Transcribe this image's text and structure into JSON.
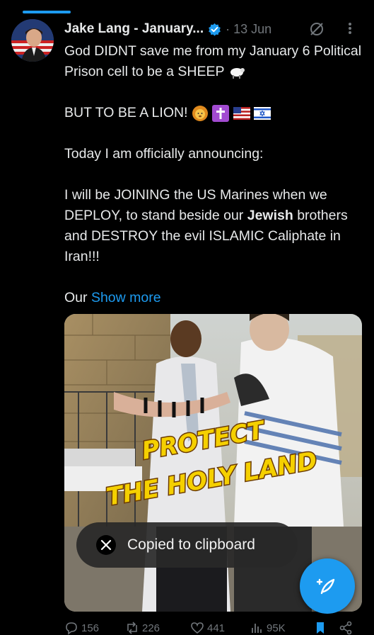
{
  "tweet": {
    "author_name": "Jake Lang - January...",
    "date": "· 13 Jun",
    "paragraphs": [
      "God DIDNT save me from my January 6 Political Prison cell to be a SHEEP",
      "BUT TO BE A LION!",
      "Today I am officially announcing:",
      "I will be JOINING the US Marines when we DEPLOY, to stand beside our",
      "Jewish",
      "brothers and DESTROY the evil ISLAMIC Caliphate in Iran!!!",
      "Our"
    ],
    "show_more": "Show more",
    "media_caption_line1": "PROTECT",
    "media_caption_line2": "THE HOLY LAND"
  },
  "toast": {
    "message": "Copied to clipboard"
  },
  "actions": {
    "replies": "156",
    "reposts": "226",
    "likes": "441",
    "views": "95K"
  },
  "icons": {
    "verified": "verified-badge-icon",
    "grok": "grok-icon",
    "more": "more-options-icon",
    "compose": "compose-post-icon",
    "x_logo": "x-logo-icon"
  },
  "colors": {
    "accent": "#1d9bf0",
    "background": "#000000",
    "text": "#e7e9ea",
    "muted": "#71767b"
  }
}
